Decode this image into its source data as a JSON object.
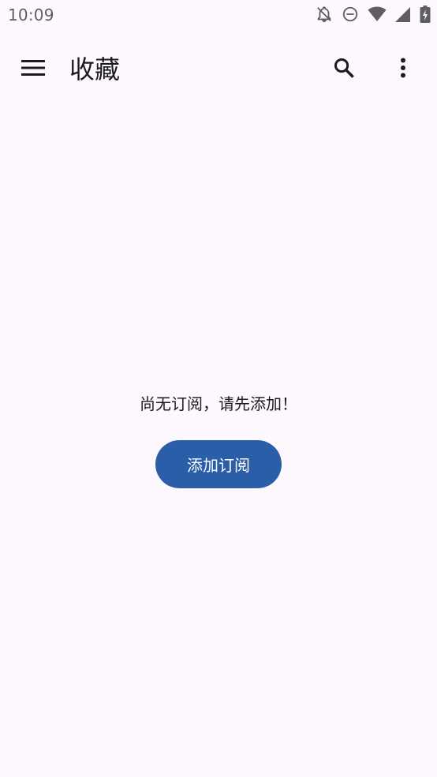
{
  "status_bar": {
    "time": "10:09",
    "icons": [
      "notifications-off-icon",
      "do-not-disturb-icon",
      "wifi-icon",
      "cell-signal-icon",
      "battery-charging-icon"
    ]
  },
  "app_bar": {
    "title": "收藏",
    "menu_icon": "menu-icon",
    "search_icon": "search-icon",
    "more_icon": "more-vert-icon"
  },
  "empty_state": {
    "message": "尚无订阅，请先添加！",
    "add_button_label": "添加订阅"
  },
  "colors": {
    "background": "#fcf8fd",
    "primary": "#2b5ea9",
    "on_primary": "#ffffff",
    "text": "#1b1b1f",
    "status_text": "#5e5e62"
  }
}
